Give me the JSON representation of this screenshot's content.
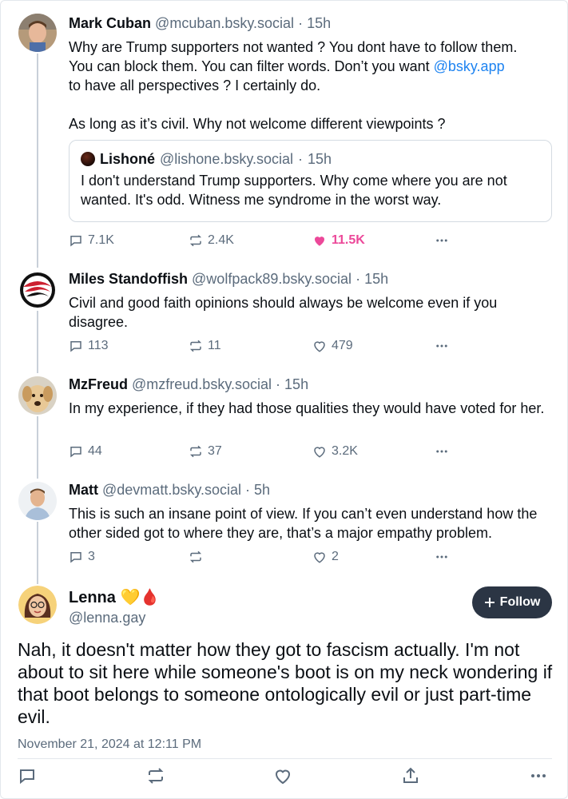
{
  "thread": [
    {
      "name": "Mark Cuban",
      "handle": "@mcuban.bsky.social",
      "time": "15h",
      "text_line1": "Why are Trump supporters not wanted ? You dont have to follow them.",
      "text_line2": "You can block them.  You can filter words.  Don’t you want ",
      "mention": "@bsky.app",
      "text_line3": "to have all perspectives ? I certainly do.",
      "text_line4": "As long as it’s civil. Why not welcome different viewpoints ?",
      "quote": {
        "name": "Lishoné",
        "handle": "@lishone.bsky.social",
        "time": "15h",
        "text": "I don't understand Trump supporters. Why come where you are not wanted. It's odd. Witness me syndrome in the worst way."
      },
      "replies": "7.1K",
      "reposts": "2.4K",
      "likes": "11.5K"
    },
    {
      "name": "Miles Standoffish",
      "handle": "@wolfpack89.bsky.social",
      "time": "15h",
      "text": "Civil and good faith opinions should always be welcome even if you disagree.",
      "replies": "113",
      "reposts": "11",
      "likes": "479"
    },
    {
      "name": "MzFreud",
      "handle": "@mzfreud.bsky.social",
      "time": "15h",
      "text": "In my experience, if they had those qualities they would have voted for her.",
      "replies": "44",
      "reposts": "37",
      "likes": "3.2K"
    },
    {
      "name": "Matt",
      "handle": "@devmatt.bsky.social",
      "time": "5h",
      "text": "This is such an insane point of view. If you can’t even understand how the other sided got to where they are, that’s a major empathy problem.",
      "replies": "3",
      "reposts": "",
      "likes": "2"
    }
  ],
  "main": {
    "name": "Lenna",
    "name_emoji": "💛🩸",
    "handle": "@lenna.gay",
    "follow_label": "Follow",
    "text": "Nah, it doesn't matter how they got to fascism actually. I'm not about to sit here while someone's boot is on my neck wondering if that boot belongs to someone ontologically evil or just part-time evil.",
    "timestamp": "November 21, 2024 at 12:11 PM"
  },
  "separator": "·",
  "colors": {
    "accent": "#1d83f1",
    "like": "#ec4899",
    "muted": "#5b6b7c",
    "button": "#2b3544"
  }
}
